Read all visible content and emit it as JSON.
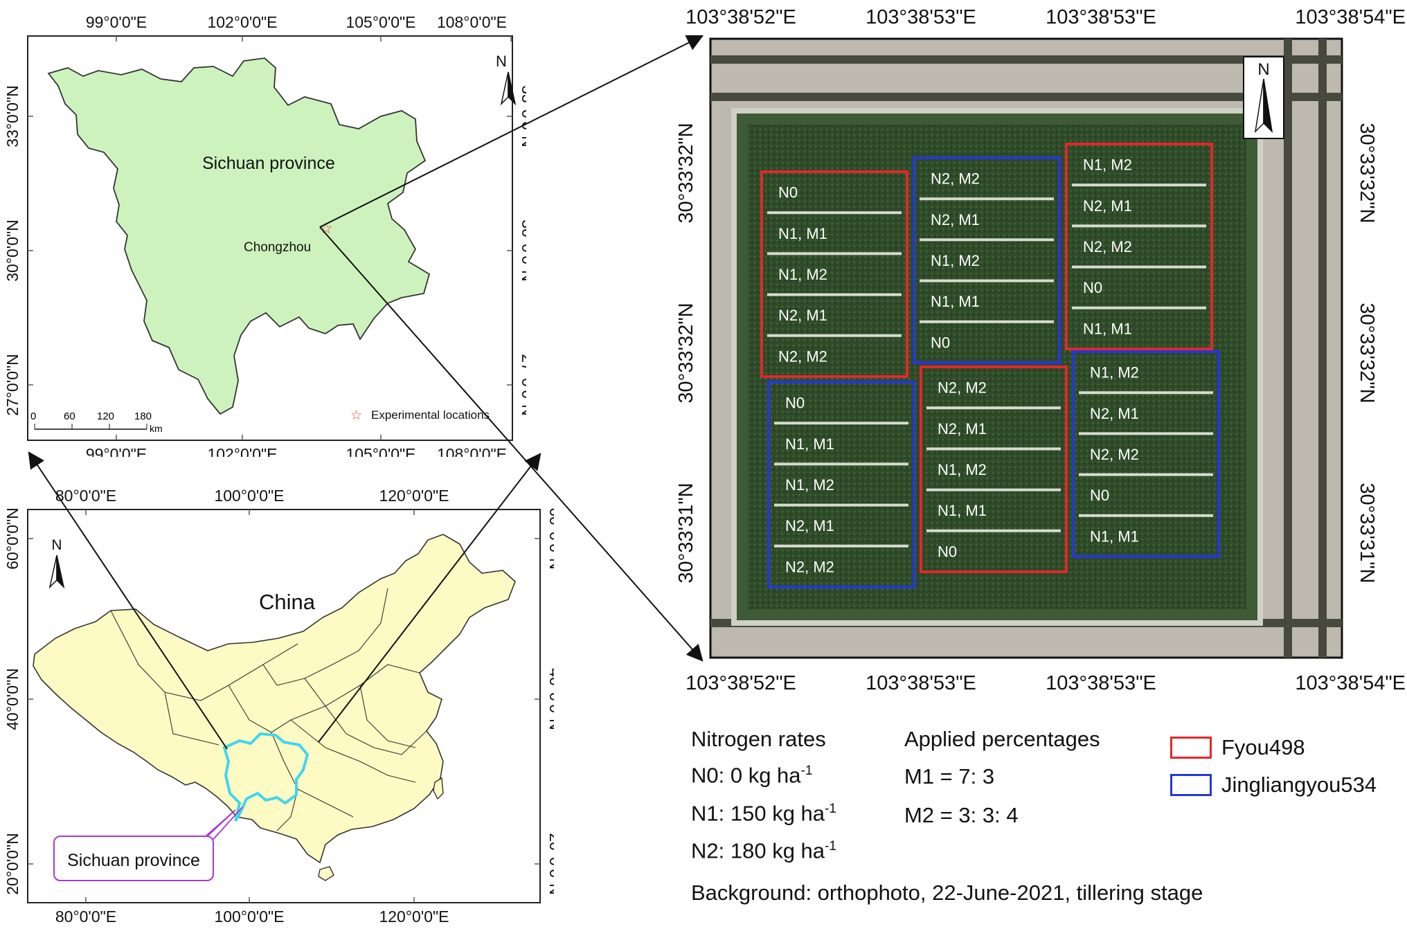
{
  "sichuan_map": {
    "top_ticks": [
      "99°0'0\"E",
      "102°0'0\"E",
      "105°0'0\"E",
      "108°0'0\"E"
    ],
    "bottom_ticks": [
      "99°0'0\"E",
      "102°0'0\"E",
      "105°0'0\"E",
      "108°0'0\"E"
    ],
    "lat_ticks": [
      "33°0'0\"N",
      "30°0'0\"N",
      "27°0'0\"N"
    ],
    "province_label": "Sichuan province",
    "site_label": "Chongzhou",
    "north": "N",
    "scalebar": {
      "ticks": [
        "0",
        "60",
        "120",
        "180"
      ],
      "unit": "km"
    },
    "legend_label": "Experimental  locations",
    "colors": {
      "land": "#cdf2be",
      "site": "#e04848"
    }
  },
  "china_map": {
    "top_ticks": [
      "80°0'0\"E",
      "100°0'0\"E",
      "120°0'0\"E"
    ],
    "bottom_ticks": [
      "80°0'0\"E",
      "100°0'0\"E",
      "120°0'0\"E"
    ],
    "lat_ticks": [
      "60°0'0\"N",
      "40°0'0\"N",
      "20°0'0\"N"
    ],
    "country_label": "China",
    "north": "N",
    "callout_label": "Sichuan province",
    "colors": {
      "land": "#fdfbc3",
      "sichuan": "#3fd6ef",
      "callout": "#a53ad0"
    }
  },
  "photo_map": {
    "top_ticks": [
      "103°38'52\"E",
      "103°38'53\"E",
      "103°38'53\"E",
      "103°38'54\"E"
    ],
    "bottom_ticks": [
      "103°38'52\"E",
      "103°38'53\"E",
      "103°38'53\"E",
      "103°38'54\"E"
    ],
    "lat_ticks": [
      "30°33'32\"N",
      "30°33'32\"N",
      "30°33'31\"N"
    ],
    "north": "N",
    "blocks": [
      {
        "variety": "Fyou498",
        "plots": [
          "N0",
          "N1, M1",
          "N1, M2",
          "N2, M1",
          "N2, M2"
        ]
      },
      {
        "variety": "Jingliangyou534",
        "plots": [
          "N2, M2",
          "N2, M1",
          "N1, M2",
          "N1, M1",
          "N0"
        ]
      },
      {
        "variety": "Fyou498",
        "plots": [
          "N1, M2",
          "N2, M1",
          "N2, M2",
          "N0",
          "N1, M1"
        ]
      },
      {
        "variety": "Jingliangyou534",
        "plots": [
          "N0",
          "N1, M1",
          "N1, M2",
          "N2, M1",
          "N2, M2"
        ]
      },
      {
        "variety": "Fyou498",
        "plots": [
          "N2, M2",
          "N2, M1",
          "N1, M2",
          "N1, M1",
          "N0"
        ]
      },
      {
        "variety": "Jingliangyou534",
        "plots": [
          "N1, M2",
          "N2, M1",
          "N2, M2",
          "N0",
          "N1, M1"
        ]
      }
    ],
    "colors": {
      "fyou498": "#e2282a",
      "jingliangyou534": "#2438d6"
    }
  },
  "legend": {
    "nitrogen_title": "Nitrogen rates",
    "nitrogen": [
      {
        "label": "N0: 0 kg ha",
        "sup": "-1"
      },
      {
        "label": "N1: 150 kg ha",
        "sup": "-1"
      },
      {
        "label": "N2: 180 kg ha",
        "sup": "-1"
      }
    ],
    "applied_title": "Applied percentages",
    "applied": [
      "M1 = 7: 3",
      "M2 = 3: 3: 4"
    ],
    "varieties": [
      {
        "name": "Fyou498",
        "color": "#e2282a"
      },
      {
        "name": "Jingliangyou534",
        "color": "#2438d6"
      }
    ],
    "background_note": "Background: orthophoto, 22-June-2021, tillering stage"
  }
}
